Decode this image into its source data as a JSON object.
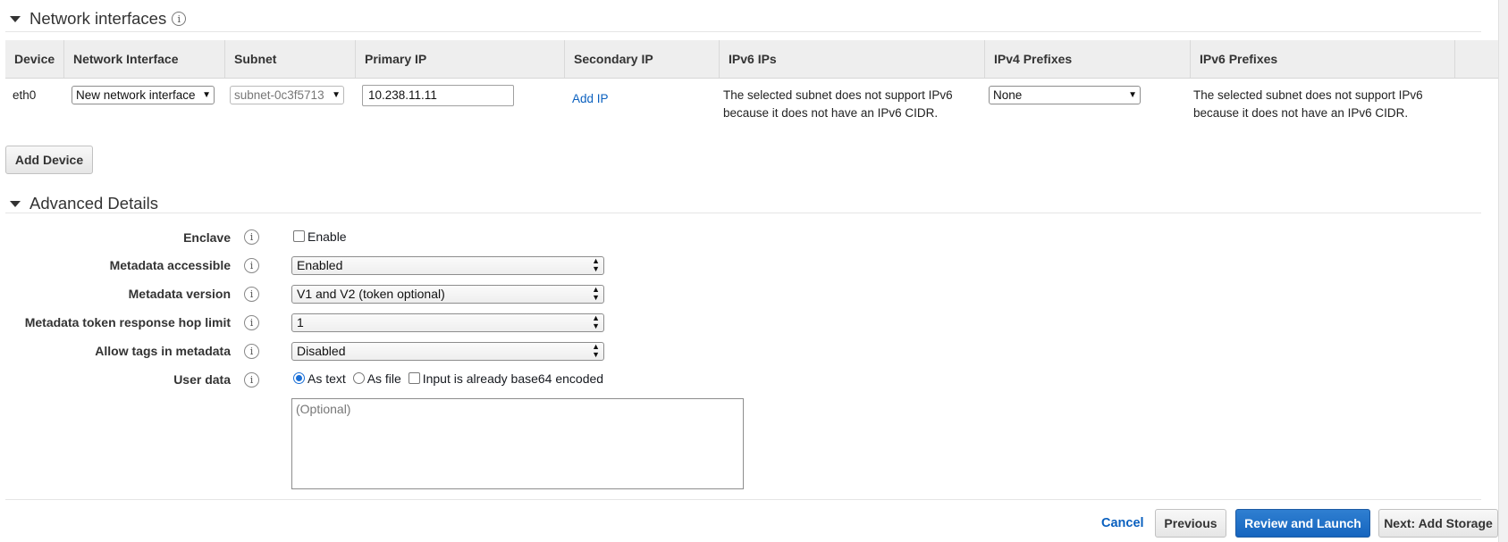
{
  "network_interfaces": {
    "title": "Network interfaces",
    "columns": [
      "Device",
      "Network Interface",
      "Subnet",
      "Primary IP",
      "Secondary IP",
      "IPv6 IPs",
      "IPv4 Prefixes",
      "IPv6 Prefixes"
    ],
    "row": {
      "device": "eth0",
      "network_interface": "New network interface",
      "subnet": "subnet-0c3f5713",
      "primary_ip": "10.238.11.11",
      "secondary_ip_link": "Add IP",
      "ipv6_ips": "The selected subnet does not support IPv6 because it does not have an IPv6 CIDR.",
      "ipv4_prefixes": "None",
      "ipv6_prefixes": "The selected subnet does not support IPv6 because it does not have an IPv6 CIDR."
    },
    "add_device_label": "Add Device"
  },
  "advanced_details": {
    "title": "Advanced Details",
    "enclave": {
      "label": "Enclave",
      "checkbox_label": "Enable",
      "checked": false
    },
    "metadata_accessible": {
      "label": "Metadata accessible",
      "value": "Enabled"
    },
    "metadata_version": {
      "label": "Metadata version",
      "value": "V1 and V2 (token optional)"
    },
    "hop_limit": {
      "label": "Metadata token response hop limit",
      "value": "1"
    },
    "allow_tags": {
      "label": "Allow tags in metadata",
      "value": "Disabled"
    },
    "user_data": {
      "label": "User data",
      "option_text": "As text",
      "option_file": "As file",
      "base64_label": "Input is already base64 encoded",
      "selected": "As text",
      "placeholder": "(Optional)"
    }
  },
  "footer": {
    "cancel": "Cancel",
    "previous": "Previous",
    "review_launch": "Review and Launch",
    "next": "Next: Add Storage"
  },
  "colors": {
    "primary": "#1665bf",
    "link": "#0a60bf"
  },
  "icons": {
    "info": "info-icon",
    "collapse": "caret-down-icon"
  }
}
